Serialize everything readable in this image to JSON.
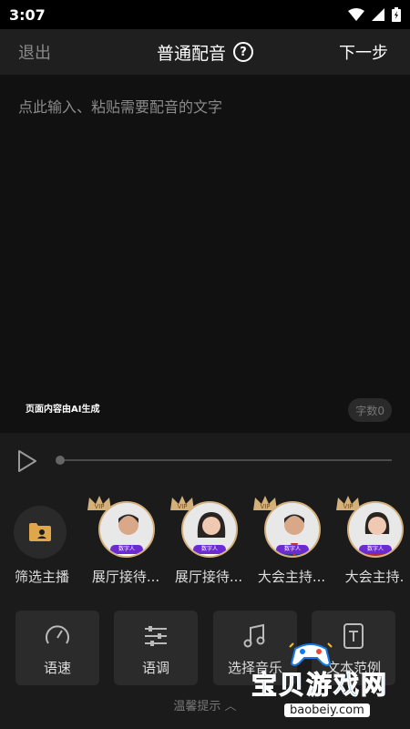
{
  "status": {
    "time": "3:07"
  },
  "header": {
    "exit_label": "退出",
    "title": "普通配音",
    "help_glyph": "?",
    "next_label": "下一步"
  },
  "editor": {
    "placeholder": "点此输入、粘贴需要配音的文字",
    "ai_note": "页面内容由AI生成",
    "word_count": "字数0"
  },
  "anchors": {
    "filter_label": "筛选主播",
    "vip_text": "VIP",
    "tag_text": "数字人",
    "items": [
      {
        "label": "展厅接待...",
        "vip": true
      },
      {
        "label": "展厅接待...",
        "vip": true
      },
      {
        "label": "大会主持...",
        "vip": true
      },
      {
        "label": "大会主持.",
        "vip": true
      }
    ]
  },
  "tools": [
    {
      "label": "语速",
      "icon": "speed-gauge-icon"
    },
    {
      "label": "语调",
      "icon": "equalizer-sliders-icon"
    },
    {
      "label": "选择音乐",
      "icon": "music-note-icon"
    },
    {
      "label": "文本范例",
      "icon": "text-document-icon"
    }
  ],
  "tips": {
    "label": "温馨提示 ︿"
  },
  "watermark": {
    "title": "宝贝游戏网",
    "url": "baobeiy.com"
  },
  "colors": {
    "background": "#1b1b1b",
    "editor_bg": "#111111",
    "vip_gold": "#d4b07a",
    "tag_purple": "#6c2bd1",
    "watermark_blue": "#1578e8"
  }
}
